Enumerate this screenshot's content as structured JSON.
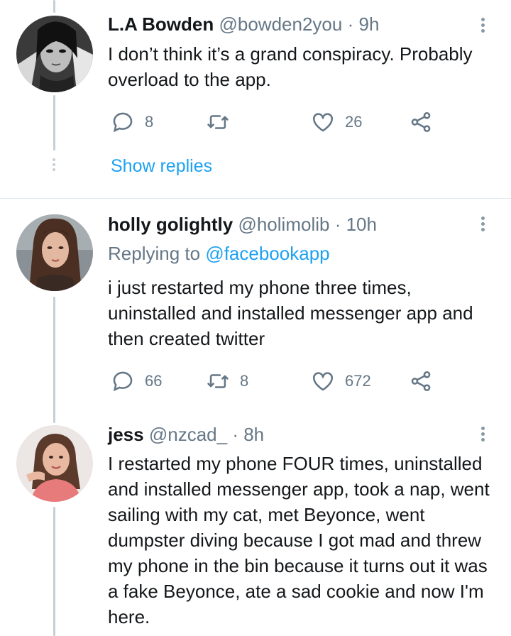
{
  "colors": {
    "accent": "#1da1f2",
    "muted": "#657786",
    "text": "#14171a",
    "thread": "#c4cfd6"
  },
  "tweets": [
    {
      "name": "L.A Bowden",
      "handle": "@bowden2you",
      "sep": "·",
      "time": "9h",
      "replying_to_label": "",
      "replying_to_handle": "",
      "text": "I don’t think it’s a grand conspiracy. Probably overload to the app.",
      "replies": "8",
      "retweets": "",
      "likes": "26",
      "avatar_icon": "avatar-photo",
      "show_replies": "Show replies"
    },
    {
      "name": "holly golightly",
      "handle": "@holimolib",
      "sep": "·",
      "time": "10h",
      "replying_to_label": "Replying to",
      "replying_to_handle": "@facebookapp",
      "text": "i just restarted my phone three times, uninstalled and installed messenger app and then created twitter",
      "replies": "66",
      "retweets": "8",
      "likes": "672",
      "avatar_icon": "avatar-photo"
    },
    {
      "name": "jess",
      "handle": "@nzcad_",
      "sep": "·",
      "time": "8h",
      "text": "I restarted my phone FOUR times, uninstalled and installed messenger app, took a nap, went sailing with my cat, met Beyonce, went dumpster diving because I got mad and threw my phone in the bin because it turns out it was a fake Beyonce, ate a sad cookie and now I'm here.",
      "avatar_icon": "avatar-photo"
    }
  ],
  "icons": {
    "reply": "reply-icon",
    "retweet": "retweet-icon",
    "like": "heart-icon",
    "share": "share-icon",
    "more": "more-vertical-icon"
  }
}
